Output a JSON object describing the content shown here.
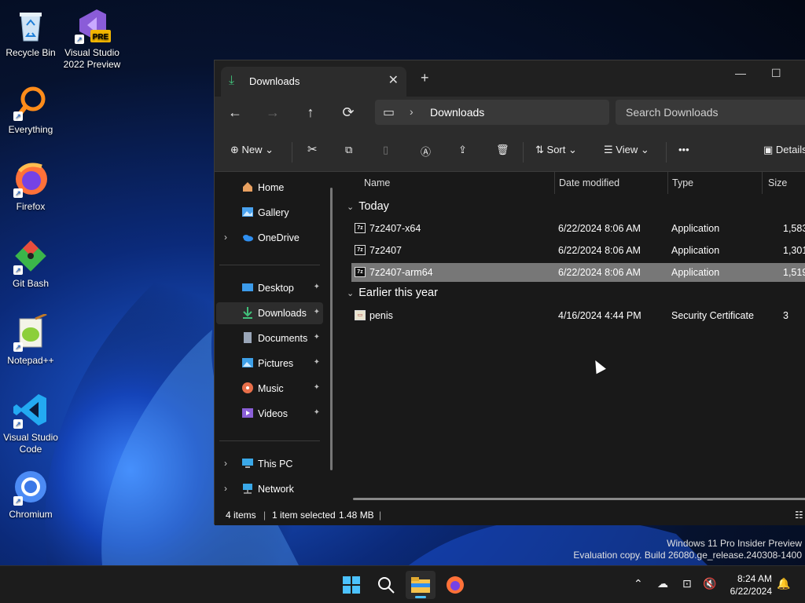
{
  "desktop": {
    "icons": [
      {
        "label": "Recycle Bin",
        "icon": "recycle-bin-icon"
      },
      {
        "label": "Visual Studio 2022 Preview",
        "icon": "visual-studio-icon",
        "badge": "PRE"
      },
      {
        "label": "Everything",
        "icon": "everything-search-icon"
      },
      {
        "label": "Firefox",
        "icon": "firefox-icon"
      },
      {
        "label": "Git Bash",
        "icon": "git-bash-icon"
      },
      {
        "label": "Notepad++",
        "icon": "notepadpp-icon"
      },
      {
        "label": "Visual Studio Code",
        "icon": "vscode-icon"
      },
      {
        "label": "Chromium",
        "icon": "chromium-icon"
      }
    ]
  },
  "window": {
    "tab_title": "Downloads",
    "tab_close": "✕",
    "new_tab": "+",
    "controls": {
      "minimize": "—",
      "maximize": "☐"
    },
    "nav": {
      "back": "←",
      "forward": "→",
      "up": "↑",
      "refresh": "⟳"
    },
    "address": {
      "chevron": "›",
      "crumb": "Downloads"
    },
    "search": {
      "placeholder": "Search Downloads"
    },
    "toolbar": {
      "new_label": "New",
      "sort_label": "Sort",
      "view_label": "View",
      "more_label": "•••",
      "details_label": "Details"
    },
    "sidebar": {
      "items": [
        {
          "label": "Home",
          "icon": "home-icon",
          "color": "#e8a060"
        },
        {
          "label": "Gallery",
          "icon": "gallery-icon",
          "color": "#4aa3f0"
        },
        {
          "label": "OneDrive",
          "icon": "onedrive-icon",
          "color": "#2f8ff0",
          "expandable": true
        },
        {
          "label": "Desktop",
          "icon": "desktop-icon",
          "color": "#3c9bea",
          "pinned": true
        },
        {
          "label": "Downloads",
          "icon": "downloads-icon",
          "color": "#41c07a",
          "pinned": true,
          "selected": true
        },
        {
          "label": "Documents",
          "icon": "documents-icon",
          "color": "#9aa6b8",
          "pinned": true
        },
        {
          "label": "Pictures",
          "icon": "pictures-icon",
          "color": "#3ea0e8",
          "pinned": true
        },
        {
          "label": "Music",
          "icon": "music-icon",
          "color": "#e86f4a",
          "pinned": true
        },
        {
          "label": "Videos",
          "icon": "videos-icon",
          "color": "#8b5fd8",
          "pinned": true
        },
        {
          "label": "This PC",
          "icon": "this-pc-icon",
          "color": "#3aa8e8",
          "expandable": true
        },
        {
          "label": "Network",
          "icon": "network-icon",
          "color": "#3aa8e8",
          "expandable": true
        }
      ],
      "pin_glyph": "📌",
      "expand_glyph": "›"
    },
    "columns": [
      "Name",
      "Date modified",
      "Type",
      "Size"
    ],
    "groups": [
      {
        "label": "Today",
        "files": [
          {
            "name": "7z2407-x64",
            "date": "6/22/2024 8:06 AM",
            "type": "Application",
            "size": "1,583",
            "icon": "7z-installer-icon"
          },
          {
            "name": "7z2407",
            "date": "6/22/2024 8:06 AM",
            "type": "Application",
            "size": "1,301",
            "icon": "7z-installer-icon"
          },
          {
            "name": "7z2407-arm64",
            "date": "6/22/2024 8:06 AM",
            "type": "Application",
            "size": "1,519",
            "icon": "7z-installer-icon",
            "selected": true
          }
        ]
      },
      {
        "label": "Earlier this year",
        "files": [
          {
            "name": "penis",
            "date": "4/16/2024 4:44 PM",
            "type": "Security Certificate",
            "size": "3",
            "icon": "certificate-icon"
          }
        ]
      }
    ],
    "status": {
      "count": "4 items",
      "selection": "1 item selected",
      "size": "1.48 MB"
    }
  },
  "watermark": {
    "line1": "Windows 11 Pro Insider Preview",
    "line2": "Evaluation copy. Build 26080.ge_release.240308-1400"
  },
  "taskbar": {
    "time": "8:24 AM",
    "date": "6/22/2024"
  }
}
